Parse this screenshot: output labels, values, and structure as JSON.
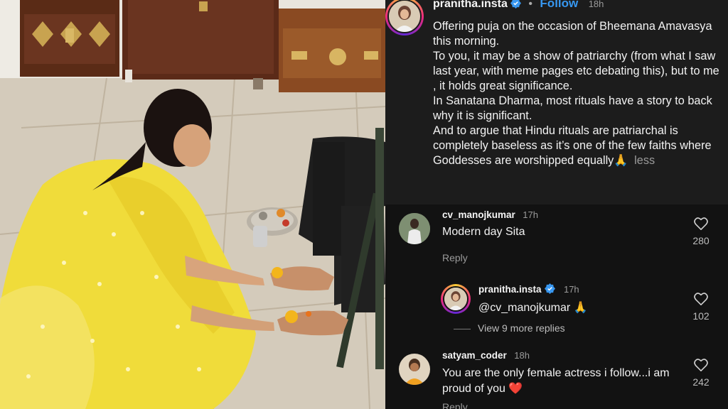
{
  "post": {
    "username": "pranitha.insta",
    "follow_label": "Follow",
    "time": "18h",
    "caption_lines": [
      "Offering puja on the occasion of Bheemana Amavasya this morning.",
      "To you, it may be a show of patriarchy (from what I saw last year, with meme pages etc debating this), but to me , it holds great significance.",
      "In Sanatana Dharma, most rituals have a story to back why it is significant.",
      "And to argue that Hindu rituals are patriarchal is completely baseless as it’s one of the few faiths where Goddesses are worshipped equally🙏"
    ],
    "less_label": "less"
  },
  "comments": [
    {
      "username": "cv_manojkumar",
      "time": "17h",
      "text": "Modern day Sita",
      "reply_label": "Reply",
      "likes": "280"
    },
    {
      "username": "pranitha.insta",
      "time": "17h",
      "text": "@cv_manojkumar 🙏",
      "likes": "102",
      "view_replies": "View 9 more replies"
    },
    {
      "username": "satyam_coder",
      "time": "18h",
      "text": "You are the only female actress i follow...i am proud of you ❤️",
      "reply_label": "Reply",
      "likes": "242"
    }
  ],
  "icons": {
    "verified": "verified-badge-icon",
    "like": "heart-outline-icon"
  },
  "colors": {
    "follow_blue": "#3797f0",
    "panel_bg": "#121212",
    "caption_bg": "#1c1c1c",
    "verified_blue": "#3897f0"
  }
}
